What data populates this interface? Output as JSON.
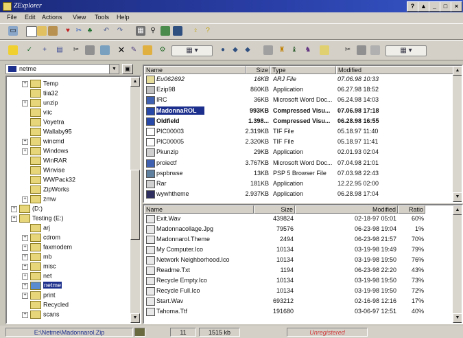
{
  "window": {
    "title": "ZExplorer",
    "buttons": [
      "?",
      "▲",
      "_",
      "□",
      "×"
    ]
  },
  "menu": [
    "File",
    "Edit",
    "Actions",
    "View",
    "Tools",
    "Help"
  ],
  "drive_selector": {
    "value": "netme"
  },
  "tree": [
    {
      "label": "Temp",
      "indent": 2,
      "plus": true
    },
    {
      "label": "tiia32",
      "indent": 2,
      "plus": false
    },
    {
      "label": "unzip",
      "indent": 2,
      "plus": true
    },
    {
      "label": "viic",
      "indent": 2,
      "plus": false
    },
    {
      "label": "Voyetra",
      "indent": 2,
      "plus": false
    },
    {
      "label": "Wallaby95",
      "indent": 2,
      "plus": false
    },
    {
      "label": "wincmd",
      "indent": 2,
      "plus": true
    },
    {
      "label": "Windows",
      "indent": 2,
      "plus": true
    },
    {
      "label": "WinRAR",
      "indent": 2,
      "plus": false
    },
    {
      "label": "Winvise",
      "indent": 2,
      "plus": false
    },
    {
      "label": "WWPack32",
      "indent": 2,
      "plus": false
    },
    {
      "label": "ZipWorks",
      "indent": 2,
      "plus": false
    },
    {
      "label": "zmw",
      "indent": 2,
      "plus": true
    },
    {
      "label": "(D:)",
      "indent": 1,
      "plus": true
    },
    {
      "label": "Testing (E:)",
      "indent": 1,
      "plus": true
    },
    {
      "label": "arj",
      "indent": 2,
      "plus": false
    },
    {
      "label": "cdrom",
      "indent": 2,
      "plus": true
    },
    {
      "label": "faxmodem",
      "indent": 2,
      "plus": true
    },
    {
      "label": "mb",
      "indent": 2,
      "plus": true
    },
    {
      "label": "misc",
      "indent": 2,
      "plus": true
    },
    {
      "label": "net",
      "indent": 2,
      "plus": true
    },
    {
      "label": "netme",
      "indent": 2,
      "plus": true,
      "selected": true
    },
    {
      "label": "print",
      "indent": 2,
      "plus": true
    },
    {
      "label": "Recycled",
      "indent": 2,
      "plus": false
    },
    {
      "label": "scans",
      "indent": 2,
      "plus": true
    }
  ],
  "upper_list": {
    "columns": [
      "Name",
      "Size",
      "Type",
      "Modified"
    ],
    "rows": [
      {
        "name": "Eu062692",
        "size": "16KB",
        "type": "ARJ File",
        "modified": "07.06.98 10:33",
        "style": "italic"
      },
      {
        "name": "Ezip98",
        "size": "860KB",
        "type": "Application",
        "modified": "06.27.98 18:52"
      },
      {
        "name": "IRC",
        "size": "36KB",
        "type": "Microsoft Word Doc...",
        "modified": "06.24.98 14:03"
      },
      {
        "name": "MadonnaROL",
        "size": "993KB",
        "type": "Compressed Visu...",
        "modified": "07.06.98 17:18",
        "style": "bold",
        "selected": true
      },
      {
        "name": "Oldfield",
        "size": "1.398...",
        "type": "Compressed Visu...",
        "modified": "06.28.98 16:55",
        "style": "bold"
      },
      {
        "name": "PIC00003",
        "size": "2.319KB",
        "type": "TIF File",
        "modified": "05.18.97 11:40"
      },
      {
        "name": "PIC00005",
        "size": "2.320KB",
        "type": "TIF File",
        "modified": "05.18.97 11:41"
      },
      {
        "name": "Pkunzip",
        "size": "29KB",
        "type": "Application",
        "modified": "02.01.93 02:04"
      },
      {
        "name": "proiectf",
        "size": "3.767KB",
        "type": "Microsoft Word Doc...",
        "modified": "07.04.98 21:01"
      },
      {
        "name": "pspbrwse",
        "size": "13KB",
        "type": "PSP 5 Browser File",
        "modified": "07.03.98 22:43"
      },
      {
        "name": "Rar",
        "size": "181KB",
        "type": "Application",
        "modified": "12.22.95 02:00"
      },
      {
        "name": "wywhtheme",
        "size": "2.937KB",
        "type": "Application",
        "modified": "06.28.98 17:04"
      }
    ]
  },
  "lower_list": {
    "columns": [
      "Name",
      "Size",
      "Modified",
      "Ratio"
    ],
    "rows": [
      {
        "name": "Exit.Wav",
        "size": "439824",
        "modified": "02-18-97 05:01",
        "ratio": "60%"
      },
      {
        "name": "Madonnacollage.Jpg",
        "size": "79576",
        "modified": "06-23-98 19:04",
        "ratio": "1%"
      },
      {
        "name": "Madonnarol.Theme",
        "size": "2494",
        "modified": "06-23-98 21:57",
        "ratio": "70%"
      },
      {
        "name": "My Computer.Ico",
        "size": "10134",
        "modified": "03-19-98 19:49",
        "ratio": "79%"
      },
      {
        "name": "Network Neighborhood.Ico",
        "size": "10134",
        "modified": "03-19-98 19:50",
        "ratio": "76%"
      },
      {
        "name": "Readme.Txt",
        "size": "1194",
        "modified": "06-23-98 22:20",
        "ratio": "43%"
      },
      {
        "name": "Recycle Empty.Ico",
        "size": "10134",
        "modified": "03-19-98 19:50",
        "ratio": "73%"
      },
      {
        "name": "Recycle Full.Ico",
        "size": "10134",
        "modified": "03-19-98 19:50",
        "ratio": "72%"
      },
      {
        "name": "Start.Wav",
        "size": "693212",
        "modified": "02-16-98 12:16",
        "ratio": "17%"
      },
      {
        "name": "Tahoma.Ttf",
        "size": "191680",
        "modified": "03-06-97 12:51",
        "ratio": "40%"
      }
    ]
  },
  "status": {
    "path": "E:\\Netme\\Madonnarol.Zip",
    "count": "11",
    "size": "1515 kb",
    "state": "Unregistered"
  },
  "colors": {
    "accent": "#1c2f8c",
    "titlebar": "#2a3fa8",
    "face": "#d4d0c8"
  }
}
